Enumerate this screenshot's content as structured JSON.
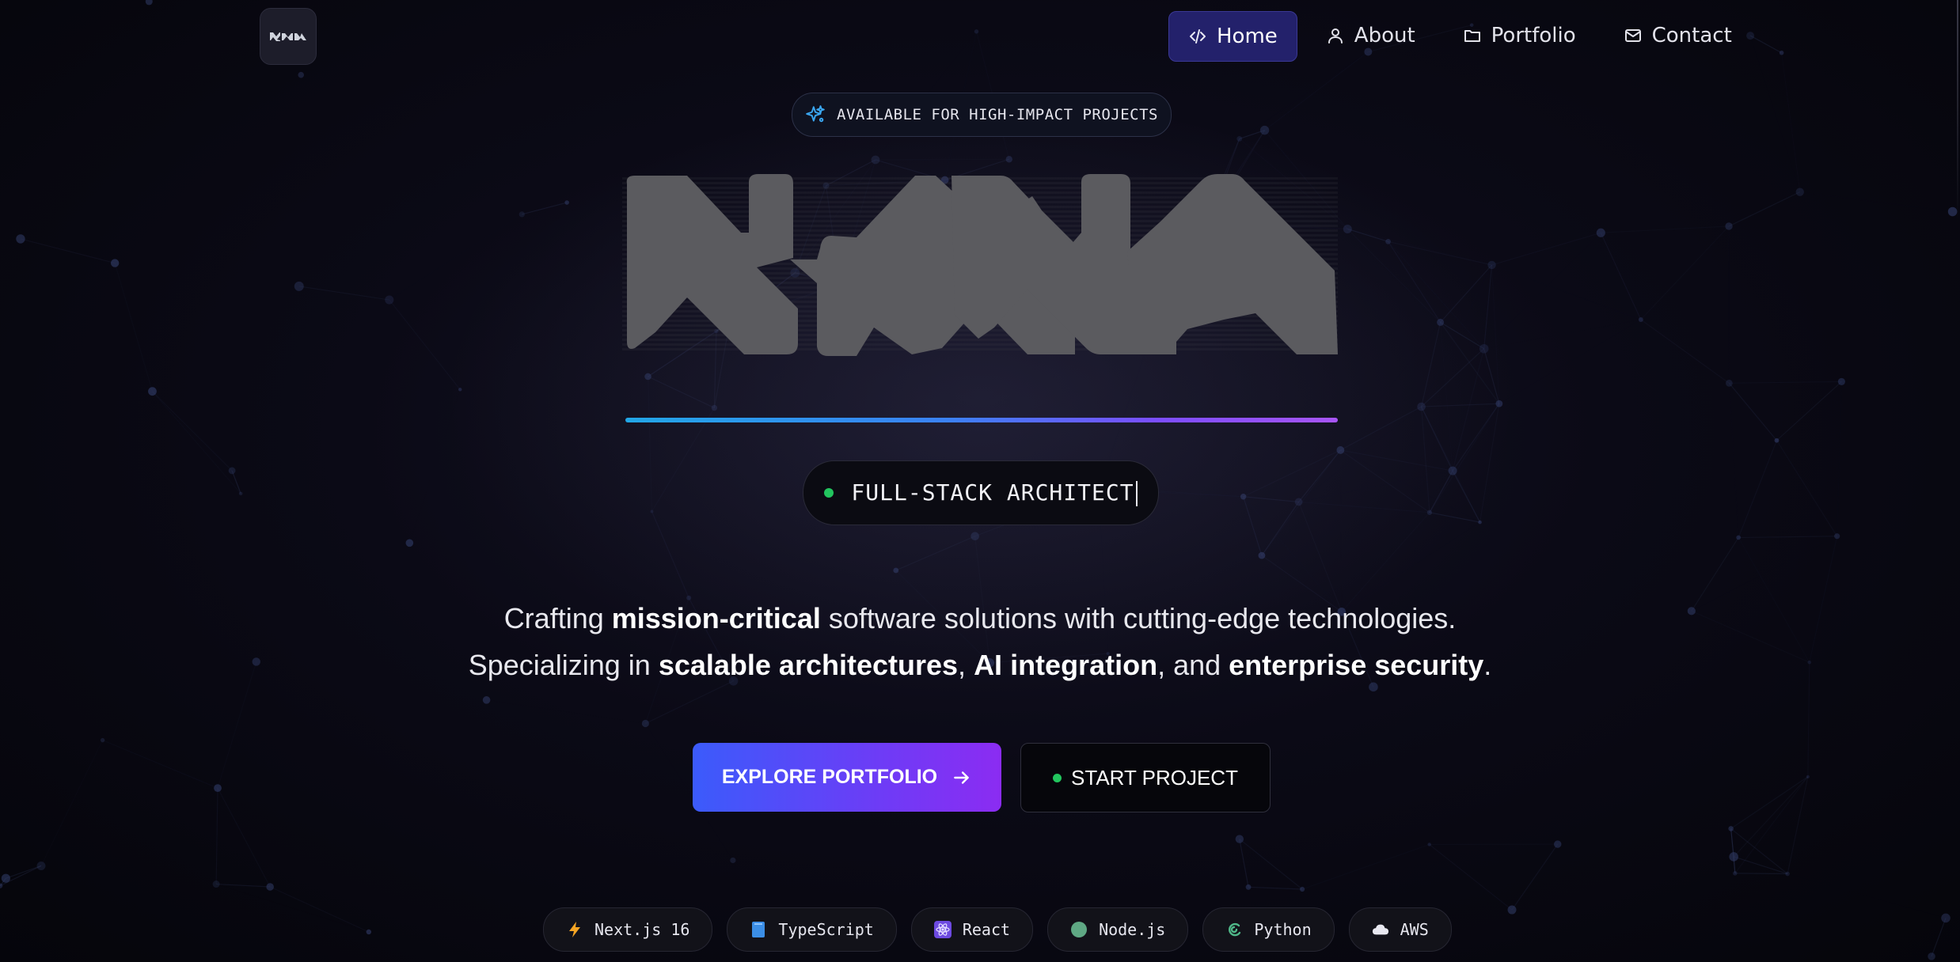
{
  "brand": {
    "logo_icon": "brand-wordmark-icon"
  },
  "nav": {
    "items": [
      {
        "label": "Home",
        "icon": "code-icon",
        "active": true
      },
      {
        "label": "About",
        "icon": "user-icon",
        "active": false
      },
      {
        "label": "Portfolio",
        "icon": "folder-icon",
        "active": false
      },
      {
        "label": "Contact",
        "icon": "mail-icon",
        "active": false
      }
    ]
  },
  "hero": {
    "badge": "AVAILABLE FOR HIGH-IMPACT PROJECTS",
    "badge_icon": "sparkles-icon",
    "role": "FULL-STACK ARCHITECT",
    "description": {
      "line1_pre": "Crafting ",
      "line1_bold": "mission-critical",
      "line1_post": " software solutions with cutting-edge technologies.",
      "line2_pre": "Specializing in ",
      "line2_bold1": "scalable architectures",
      "line2_sep1": ", ",
      "line2_bold2": "AI integration",
      "line2_sep2": ", and ",
      "line2_bold3": "enterprise security",
      "line2_end": "."
    },
    "cta_primary": "EXPLORE PORTFOLIO",
    "cta_secondary": "START PROJECT"
  },
  "tech_stack": [
    {
      "label": "Next.js 16",
      "icon": "lightning-icon"
    },
    {
      "label": "TypeScript",
      "icon": "blue-book-icon"
    },
    {
      "label": "React",
      "icon": "react-atom-icon"
    },
    {
      "label": "Node.js",
      "icon": "green-circle-icon"
    },
    {
      "label": "Python",
      "icon": "python-snake-icon"
    },
    {
      "label": "AWS",
      "icon": "cloud-icon"
    }
  ],
  "colors": {
    "background": "#07070e",
    "nav_active": "#23216b",
    "accent_blue": "#3b5bfb",
    "accent_purple": "#8b2cf2",
    "status_green": "#22c55e"
  }
}
